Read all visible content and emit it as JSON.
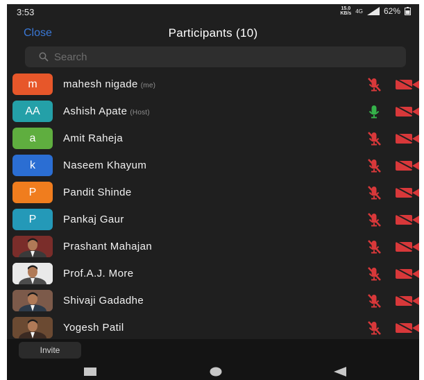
{
  "status_bar": {
    "time": "3:53",
    "net_speed_top": "15.0",
    "net_speed_bottom": "KB/s",
    "signal_label": "4G",
    "battery": "62%"
  },
  "header": {
    "close_label": "Close",
    "title": "Participants (10)"
  },
  "search": {
    "placeholder": "Search"
  },
  "colors": {
    "accent": "#3a78d6",
    "muted_red": "#d8383a",
    "unmuted_green": "#35b24a",
    "background": "#1f1f1f"
  },
  "participants": [
    {
      "name": "mahesh nigade",
      "tag": "(me)",
      "initial": "m",
      "avatar_color": "#e7572a",
      "photo": false,
      "mic": "muted",
      "video": "off"
    },
    {
      "name": "Ashish Apate",
      "tag": "(Host)",
      "initial": "AA",
      "avatar_color": "#24a0a8",
      "photo": false,
      "mic": "on",
      "video": "off"
    },
    {
      "name": "Amit Raheja",
      "tag": "",
      "initial": "a",
      "avatar_color": "#5fae3f",
      "photo": false,
      "mic": "muted",
      "video": "off"
    },
    {
      "name": "Naseem Khayum",
      "tag": "",
      "initial": "k",
      "avatar_color": "#2b6ed3",
      "photo": false,
      "mic": "muted",
      "video": "off"
    },
    {
      "name": "Pandit Shinde",
      "tag": "",
      "initial": "P",
      "avatar_color": "#f07d1e",
      "photo": false,
      "mic": "muted",
      "video": "off"
    },
    {
      "name": "Pankaj Gaur",
      "tag": "",
      "initial": "P",
      "avatar_color": "#2499b8",
      "photo": false,
      "mic": "muted",
      "video": "off"
    },
    {
      "name": "Prashant Mahajan",
      "tag": "",
      "initial": "",
      "avatar_color": "#7a2d2a",
      "photo": true,
      "mic": "muted",
      "video": "off"
    },
    {
      "name": "Prof.A.J. More",
      "tag": "",
      "initial": "",
      "avatar_color": "#e9e9e9",
      "photo": true,
      "mic": "muted",
      "video": "off"
    },
    {
      "name": "Shivaji Gadadhe",
      "tag": "",
      "initial": "",
      "avatar_color": "#7c5a4a",
      "photo": true,
      "mic": "muted",
      "video": "off"
    },
    {
      "name": "Yogesh Patil",
      "tag": "",
      "initial": "",
      "avatar_color": "#6b4a32",
      "photo": true,
      "mic": "muted",
      "video": "off"
    }
  ],
  "footer": {
    "invite_label": "Invite"
  },
  "nav": {
    "recents": "recents-square-icon",
    "home": "home-circle-icon",
    "back": "back-triangle-icon"
  }
}
